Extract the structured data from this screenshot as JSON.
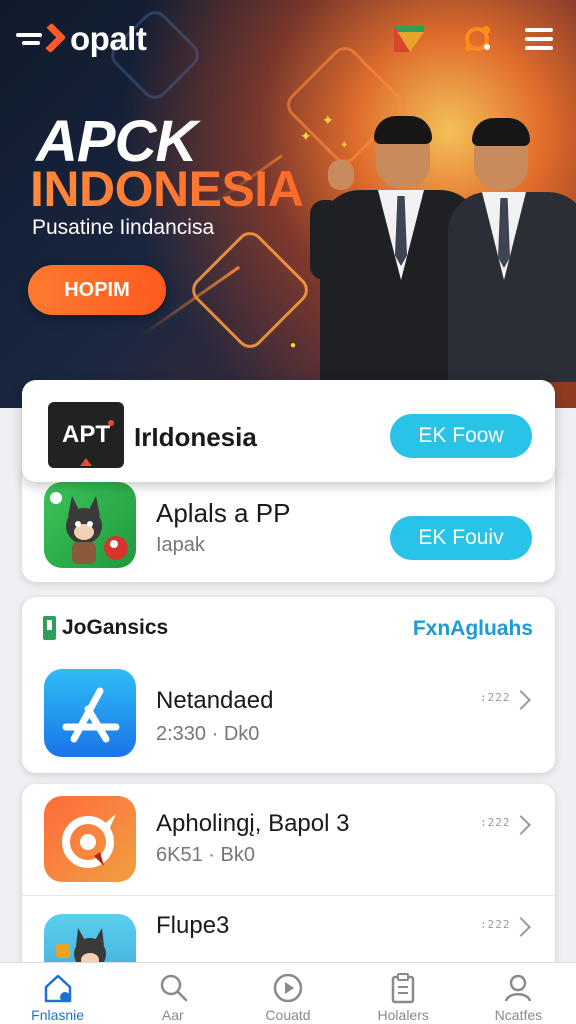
{
  "header": {
    "logo_text": "opalt"
  },
  "hero": {
    "title_line1": "APCK",
    "title_line2": "INDONESIA",
    "subtitle": "Pusatine Iindancisa",
    "cta_label": "HOPIM"
  },
  "featured": [
    {
      "icon_text": "APT",
      "title": "IrIdonesia",
      "button_label": "EK Foow",
      "icon": "apt-logo-icon"
    },
    {
      "title": "Aplals a PP",
      "subtitle": "Iapak",
      "button_label": "EK Fouiv",
      "icon": "cat-game-icon"
    }
  ],
  "section": {
    "title": "JoGansics",
    "link_label": "FxnAgluahs"
  },
  "list": [
    {
      "title": "Netandaed",
      "meta": "2:330 · Dk0",
      "dots": ":222",
      "icon": "app-store-icon"
    },
    {
      "title": "Apholingį, Bapol 3",
      "meta": "6K51 · Bk0",
      "dots": ":222",
      "icon": "orange-circle-icon"
    },
    {
      "title": "Flupe3",
      "meta": "",
      "dots": ":222",
      "icon": "cat-game-icon"
    }
  ],
  "bottom_nav": [
    {
      "label": "Fnlasnie",
      "icon": "home-icon",
      "active": true
    },
    {
      "label": "Aar",
      "icon": "search-icon",
      "active": false
    },
    {
      "label": "Couatd",
      "icon": "play-icon",
      "active": false
    },
    {
      "label": "Holalers",
      "icon": "clipboard-icon",
      "active": false
    },
    {
      "label": "Ncatfes",
      "icon": "profile-icon",
      "active": false
    }
  ],
  "colors": {
    "accent_orange": "#ff6a2a",
    "accent_blue": "#29c3e8",
    "nav_active": "#1f6fd0"
  }
}
